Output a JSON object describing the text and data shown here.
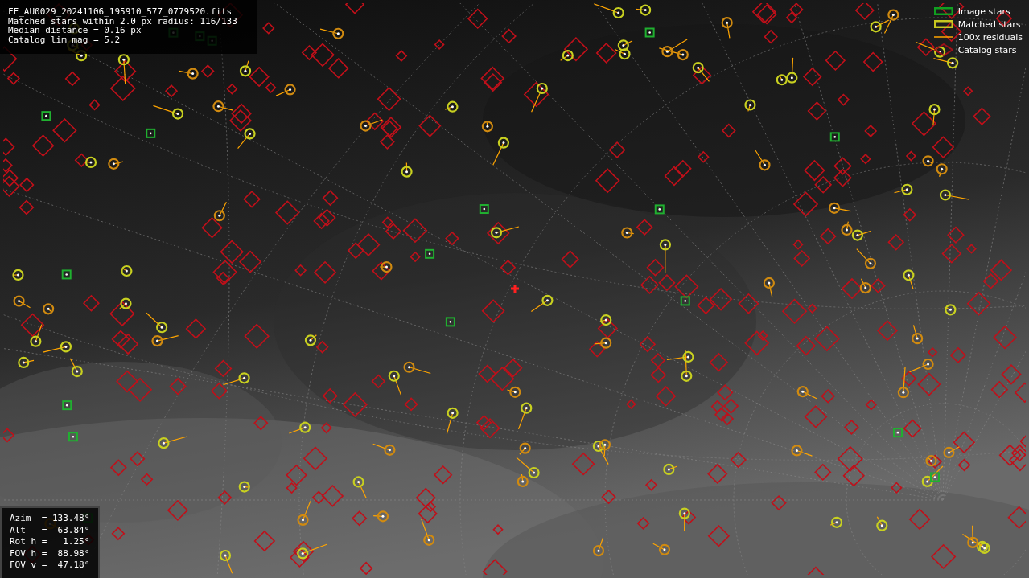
{
  "info_lines": [
    "FF_AU0029_20241106_195910_577_0779520.fits",
    "Matched stars within 2.0 px radius: 116/133",
    "Median distance = 0.16 px",
    "Catalog lim mag = 5.2"
  ],
  "legend": [
    {
      "label": "Image stars"
    },
    {
      "kind": "matched",
      "label": "Matched stars"
    },
    {
      "kind": "residual",
      "label": "100x residuals"
    },
    {
      "kind": "catalog",
      "label": "Catalog stars"
    }
  ],
  "pointing": [
    "Azim  = 133.48°",
    "Alt   =  63.84°",
    "Rot h =   1.25°",
    "FOV h =  88.98°",
    "FOV v =  47.18°"
  ]
}
